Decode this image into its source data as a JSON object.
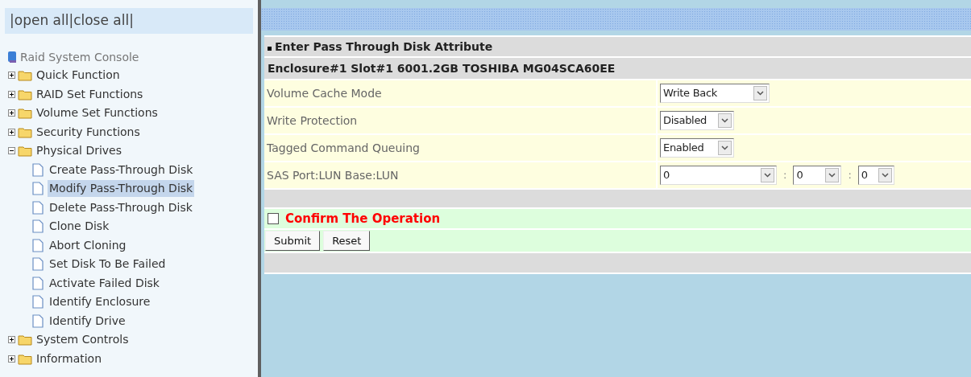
{
  "sidebar": {
    "links": [
      "|open all|close all|"
    ],
    "root": "Raid System Console",
    "tree": [
      {
        "label": "Quick Function",
        "expanded": false
      },
      {
        "label": "RAID Set Functions",
        "expanded": false
      },
      {
        "label": "Volume Set Functions",
        "expanded": false
      },
      {
        "label": "Security Functions",
        "expanded": false
      },
      {
        "label": "Physical Drives",
        "expanded": true,
        "children": [
          {
            "label": "Create Pass-Through Disk",
            "selected": false
          },
          {
            "label": "Modify Pass-Through Disk",
            "selected": true
          },
          {
            "label": "Delete Pass-Through Disk",
            "selected": false
          },
          {
            "label": "Clone Disk",
            "selected": false
          },
          {
            "label": "Abort Cloning",
            "selected": false
          },
          {
            "label": "Set Disk To Be Failed",
            "selected": false
          },
          {
            "label": "Activate Failed Disk",
            "selected": false
          },
          {
            "label": "Identify Enclosure",
            "selected": false
          },
          {
            "label": "Identify Drive",
            "selected": false
          }
        ]
      },
      {
        "label": "System Controls",
        "expanded": false
      },
      {
        "label": "Information",
        "expanded": false
      }
    ]
  },
  "form": {
    "title": "Enter Pass Through Disk Attribute",
    "subtitle": "Enclosure#1 Slot#1 6001.2GB TOSHIBA MG04SCA60EE",
    "rows": [
      {
        "label": "Volume Cache Mode",
        "selects": [
          {
            "value": "Write Back"
          }
        ]
      },
      {
        "label": "Write Protection",
        "selects": [
          {
            "value": "Disabled"
          }
        ]
      },
      {
        "label": "Tagged Command Queuing",
        "selects": [
          {
            "value": "Enabled"
          }
        ]
      },
      {
        "label": "SAS Port:LUN Base:LUN",
        "selects": [
          {
            "value": "0"
          },
          {
            "value": "0"
          },
          {
            "value": "0"
          }
        ],
        "separators": [
          ":",
          ":"
        ]
      }
    ],
    "confirm": {
      "label": "Confirm The Operation",
      "checked": false
    },
    "buttons": [
      "Submit",
      "Reset"
    ]
  }
}
